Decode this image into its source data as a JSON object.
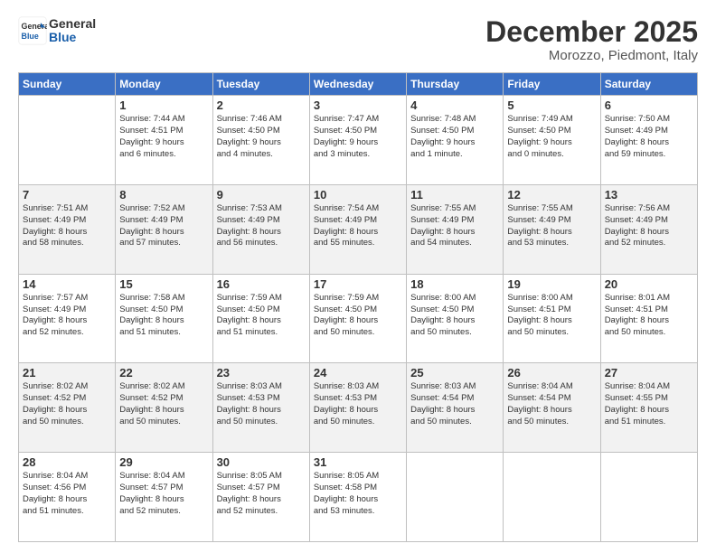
{
  "header": {
    "logo_line1": "General",
    "logo_line2": "Blue",
    "month": "December 2025",
    "location": "Morozzo, Piedmont, Italy"
  },
  "days_of_week": [
    "Sunday",
    "Monday",
    "Tuesday",
    "Wednesday",
    "Thursday",
    "Friday",
    "Saturday"
  ],
  "weeks": [
    [
      {
        "day": "",
        "info": ""
      },
      {
        "day": "1",
        "info": "Sunrise: 7:44 AM\nSunset: 4:51 PM\nDaylight: 9 hours\nand 6 minutes."
      },
      {
        "day": "2",
        "info": "Sunrise: 7:46 AM\nSunset: 4:50 PM\nDaylight: 9 hours\nand 4 minutes."
      },
      {
        "day": "3",
        "info": "Sunrise: 7:47 AM\nSunset: 4:50 PM\nDaylight: 9 hours\nand 3 minutes."
      },
      {
        "day": "4",
        "info": "Sunrise: 7:48 AM\nSunset: 4:50 PM\nDaylight: 9 hours\nand 1 minute."
      },
      {
        "day": "5",
        "info": "Sunrise: 7:49 AM\nSunset: 4:50 PM\nDaylight: 9 hours\nand 0 minutes."
      },
      {
        "day": "6",
        "info": "Sunrise: 7:50 AM\nSunset: 4:49 PM\nDaylight: 8 hours\nand 59 minutes."
      }
    ],
    [
      {
        "day": "7",
        "info": "Sunrise: 7:51 AM\nSunset: 4:49 PM\nDaylight: 8 hours\nand 58 minutes."
      },
      {
        "day": "8",
        "info": "Sunrise: 7:52 AM\nSunset: 4:49 PM\nDaylight: 8 hours\nand 57 minutes."
      },
      {
        "day": "9",
        "info": "Sunrise: 7:53 AM\nSunset: 4:49 PM\nDaylight: 8 hours\nand 56 minutes."
      },
      {
        "day": "10",
        "info": "Sunrise: 7:54 AM\nSunset: 4:49 PM\nDaylight: 8 hours\nand 55 minutes."
      },
      {
        "day": "11",
        "info": "Sunrise: 7:55 AM\nSunset: 4:49 PM\nDaylight: 8 hours\nand 54 minutes."
      },
      {
        "day": "12",
        "info": "Sunrise: 7:55 AM\nSunset: 4:49 PM\nDaylight: 8 hours\nand 53 minutes."
      },
      {
        "day": "13",
        "info": "Sunrise: 7:56 AM\nSunset: 4:49 PM\nDaylight: 8 hours\nand 52 minutes."
      }
    ],
    [
      {
        "day": "14",
        "info": "Sunrise: 7:57 AM\nSunset: 4:49 PM\nDaylight: 8 hours\nand 52 minutes."
      },
      {
        "day": "15",
        "info": "Sunrise: 7:58 AM\nSunset: 4:50 PM\nDaylight: 8 hours\nand 51 minutes."
      },
      {
        "day": "16",
        "info": "Sunrise: 7:59 AM\nSunset: 4:50 PM\nDaylight: 8 hours\nand 51 minutes."
      },
      {
        "day": "17",
        "info": "Sunrise: 7:59 AM\nSunset: 4:50 PM\nDaylight: 8 hours\nand 50 minutes."
      },
      {
        "day": "18",
        "info": "Sunrise: 8:00 AM\nSunset: 4:50 PM\nDaylight: 8 hours\nand 50 minutes."
      },
      {
        "day": "19",
        "info": "Sunrise: 8:00 AM\nSunset: 4:51 PM\nDaylight: 8 hours\nand 50 minutes."
      },
      {
        "day": "20",
        "info": "Sunrise: 8:01 AM\nSunset: 4:51 PM\nDaylight: 8 hours\nand 50 minutes."
      }
    ],
    [
      {
        "day": "21",
        "info": "Sunrise: 8:02 AM\nSunset: 4:52 PM\nDaylight: 8 hours\nand 50 minutes."
      },
      {
        "day": "22",
        "info": "Sunrise: 8:02 AM\nSunset: 4:52 PM\nDaylight: 8 hours\nand 50 minutes."
      },
      {
        "day": "23",
        "info": "Sunrise: 8:03 AM\nSunset: 4:53 PM\nDaylight: 8 hours\nand 50 minutes."
      },
      {
        "day": "24",
        "info": "Sunrise: 8:03 AM\nSunset: 4:53 PM\nDaylight: 8 hours\nand 50 minutes."
      },
      {
        "day": "25",
        "info": "Sunrise: 8:03 AM\nSunset: 4:54 PM\nDaylight: 8 hours\nand 50 minutes."
      },
      {
        "day": "26",
        "info": "Sunrise: 8:04 AM\nSunset: 4:54 PM\nDaylight: 8 hours\nand 50 minutes."
      },
      {
        "day": "27",
        "info": "Sunrise: 8:04 AM\nSunset: 4:55 PM\nDaylight: 8 hours\nand 51 minutes."
      }
    ],
    [
      {
        "day": "28",
        "info": "Sunrise: 8:04 AM\nSunset: 4:56 PM\nDaylight: 8 hours\nand 51 minutes."
      },
      {
        "day": "29",
        "info": "Sunrise: 8:04 AM\nSunset: 4:57 PM\nDaylight: 8 hours\nand 52 minutes."
      },
      {
        "day": "30",
        "info": "Sunrise: 8:05 AM\nSunset: 4:57 PM\nDaylight: 8 hours\nand 52 minutes."
      },
      {
        "day": "31",
        "info": "Sunrise: 8:05 AM\nSunset: 4:58 PM\nDaylight: 8 hours\nand 53 minutes."
      },
      {
        "day": "",
        "info": ""
      },
      {
        "day": "",
        "info": ""
      },
      {
        "day": "",
        "info": ""
      }
    ]
  ]
}
